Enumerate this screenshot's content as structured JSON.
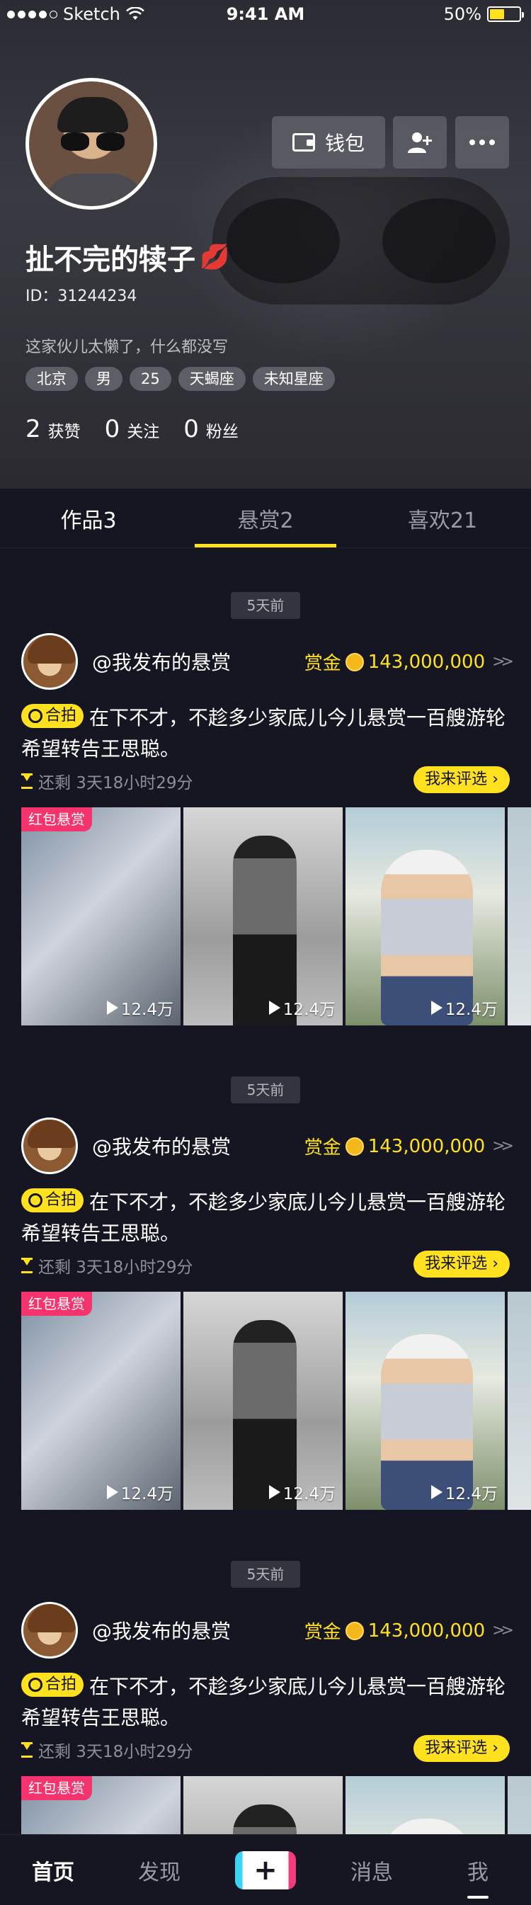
{
  "status_bar": {
    "carrier": "Sketch",
    "time": "9:41 AM",
    "battery": "50%",
    "battery_level": 0.5
  },
  "profile": {
    "nickname": "扯不完的犊子",
    "id_text": "ID：31244234",
    "bio": "这家伙儿太懒了，什么都没写",
    "tags": [
      "北京",
      "男",
      "25",
      "天蝎座",
      "未知星座"
    ],
    "stats": [
      {
        "num": "2",
        "label": "获赞"
      },
      {
        "num": "0",
        "label": "关注"
      },
      {
        "num": "0",
        "label": "粉丝"
      }
    ]
  },
  "header_buttons": {
    "wallet_label": "钱包"
  },
  "tabs": [
    "作品3",
    "悬赏2",
    "喜欢21"
  ],
  "active_tab": 1,
  "posts": [
    {
      "time": "5天前",
      "user": "@我发布的悬赏",
      "bounty_label": "赏金",
      "bounty_amount": "143,000,000",
      "hepai": "合拍",
      "text": "在下不才，不趁多少家底儿今儿悬赏一百艘游轮希望转告王思聪。",
      "remaining": "还剩 3天18小时29分",
      "judge_button": "我来评选",
      "badge": "红包悬赏",
      "thumbs": [
        {
          "views": "12.4万"
        },
        {
          "views": "12.4万"
        },
        {
          "views": "12.4万"
        }
      ]
    },
    {
      "time": "5天前",
      "user": "@我发布的悬赏",
      "bounty_label": "赏金",
      "bounty_amount": "143,000,000",
      "hepai": "合拍",
      "text": "在下不才，不趁多少家底儿今儿悬赏一百艘游轮希望转告王思聪。",
      "remaining": "还剩 3天18小时29分",
      "judge_button": "我来评选",
      "badge": "红包悬赏",
      "thumbs": [
        {
          "views": "12.4万"
        },
        {
          "views": "12.4万"
        },
        {
          "views": "12.4万"
        }
      ]
    },
    {
      "time": "5天前",
      "user": "@我发布的悬赏",
      "bounty_label": "赏金",
      "bounty_amount": "143,000,000",
      "hepai": "合拍",
      "text": "在下不才，不趁多少家底儿今儿悬赏一百艘游轮希望转告王思聪。",
      "remaining": "还剩 3天18小时29分",
      "judge_button": "我来评选",
      "badge": "红包悬赏",
      "thumbs": []
    }
  ],
  "tabbar": {
    "home": "首页",
    "discover": "发现",
    "create": "+",
    "messages": "消息",
    "me": "我"
  },
  "colors": {
    "accent": "#FFE11F",
    "background": "#161622",
    "badge_red": "#F5336C"
  }
}
